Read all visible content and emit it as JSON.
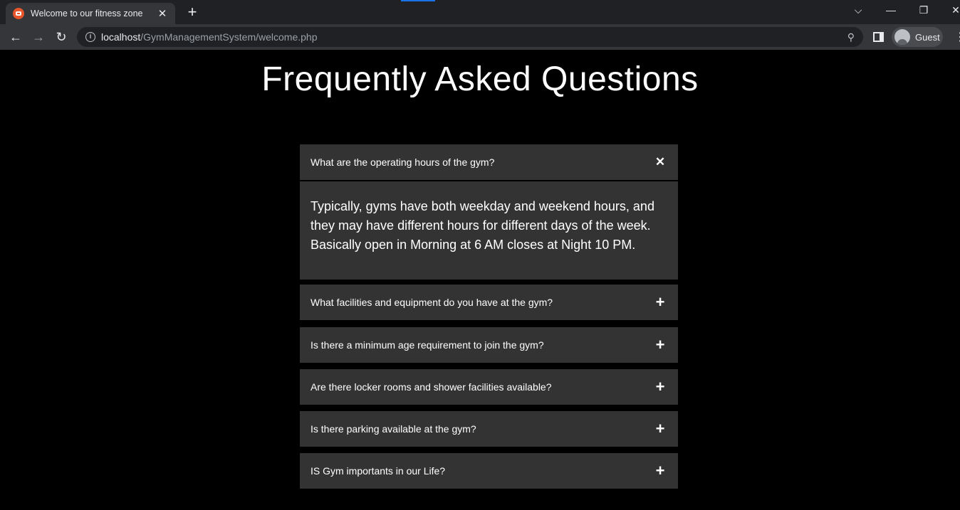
{
  "browser": {
    "tab_title": "Welcome to our fitness zone",
    "tab_close": "✕",
    "new_tab": "+",
    "url_host": "localhost",
    "url_path": "/GymManagementSystem/welcome.php",
    "profile_label": "Guest"
  },
  "page": {
    "title": "Frequently Asked Questions",
    "faqs": [
      {
        "question": "What are the operating hours of the gym?",
        "toggle": "✕",
        "expanded": true,
        "answer": "Typically, gyms have both weekday and weekend hours, and they may have different hours for different days of the week. Basically open in Morning at 6 AM closes at Night 10 PM."
      },
      {
        "question": "What facilities and equipment do you have at the gym?",
        "toggle": "+",
        "expanded": false
      },
      {
        "question": "Is there a minimum age requirement to join the gym?",
        "toggle": "+",
        "expanded": false
      },
      {
        "question": "Are there locker rooms and shower facilities available?",
        "toggle": "+",
        "expanded": false
      },
      {
        "question": "Is there parking available at the gym?",
        "toggle": "+",
        "expanded": false
      },
      {
        "question": "IS Gym importants in our Life?",
        "toggle": "+",
        "expanded": false
      }
    ]
  },
  "colors": {
    "page_bg": "#000000",
    "faq_bg": "#333333",
    "text": "#ffffff",
    "chrome_bg": "#202124",
    "toolbar_bg": "#35363a",
    "accent": "#1a73e8"
  }
}
